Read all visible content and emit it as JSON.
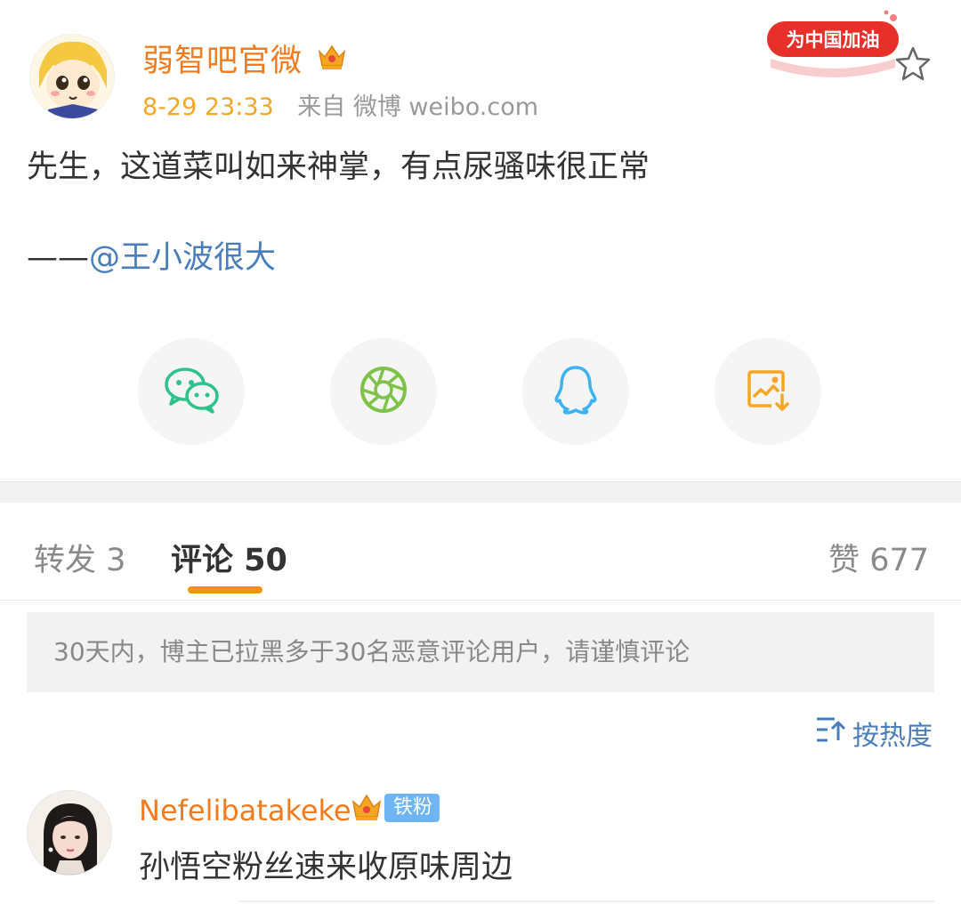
{
  "post": {
    "author": "弱智吧官微",
    "time": "8-29 23:33",
    "source": "来自 微博 weibo.com",
    "promo_label": "为中国加油",
    "body": "先生，这道菜叫如来神掌，有点尿骚味很正常",
    "credit_prefix": "——",
    "mention": "@王小波很大"
  },
  "share": {
    "items": [
      {
        "icon": "wechat-icon"
      },
      {
        "icon": "moments-icon"
      },
      {
        "icon": "qq-icon"
      },
      {
        "icon": "save-image-icon"
      }
    ]
  },
  "tabs": {
    "repost": "转发 3",
    "comments": "评论 50",
    "likes": "赞 677"
  },
  "notice": "30天内，博主已拉黑多于30名恶意评论用户，请谨慎评论",
  "sort_label": "按热度",
  "comments": [
    {
      "user": "Nefelibatakeke",
      "badge": "铁粉",
      "text": "孙悟空粉丝速来收原味周边"
    }
  ],
  "colors": {
    "username": "#f37b1d",
    "link": "#4a7dbb",
    "accent": "#f5920b",
    "wechat": "#2dc38b",
    "qq": "#3cb4f4",
    "save": "#f5a623"
  }
}
